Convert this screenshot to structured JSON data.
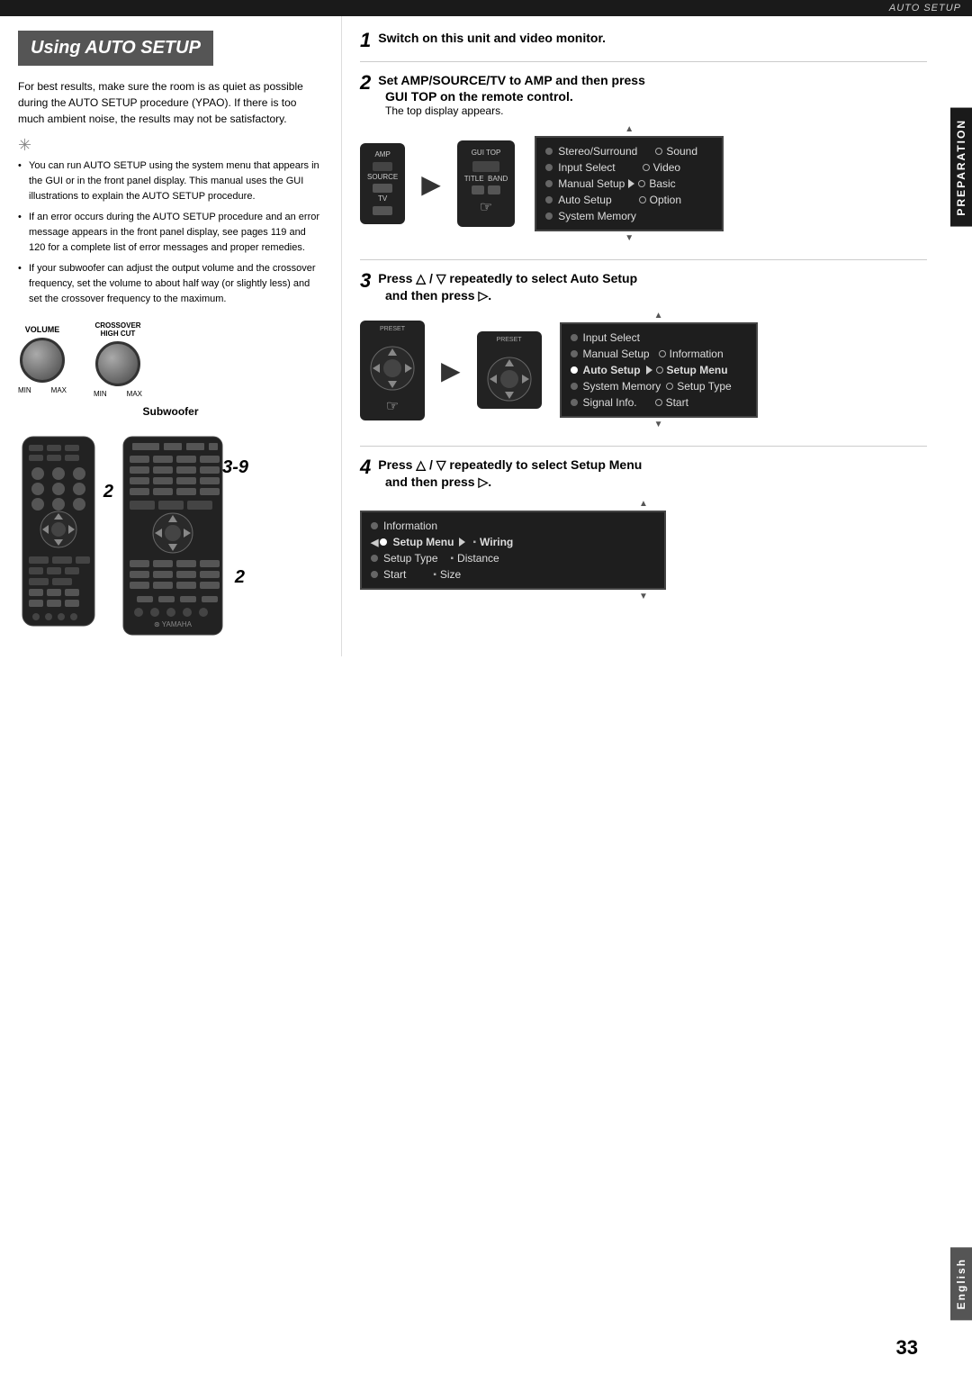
{
  "top_bar": {
    "label": "AUTO SETUP"
  },
  "section": {
    "title": "Using AUTO SETUP"
  },
  "left_col": {
    "intro": "For best results, make sure the room is as quiet as possible during the AUTO SETUP procedure (YPAO). If there is too much ambient noise, the results may not be satisfactory.",
    "tip_bullets": [
      "You can run AUTO SETUP using the system menu that appears in the GUI or in the front panel display. This manual uses the GUI illustrations to explain the AUTO SETUP procedure.",
      "If an error occurs during the AUTO SETUP procedure and an error message appears in the front panel display, see pages 119 and 120 for a complete list of error messages and proper remedies.",
      "If your subwoofer can adjust the output volume and the crossover frequency, set the volume to about half way (or slightly less) and set the crossover frequency to the maximum."
    ],
    "subwoofer_label": "Subwoofer",
    "knob1_label": "VOLUME",
    "knob2_label": "CROSSOVER\nHIGH CUT",
    "knob1_min": "MIN",
    "knob1_max": "MAX",
    "knob2_min": "MIN",
    "knob2_max": "MAX",
    "remote_num1": "2",
    "remote_num2": "3-9",
    "remote_num3": "2"
  },
  "side_tab": {
    "label": "PREPARATION"
  },
  "side_tab_bottom": {
    "label": "English"
  },
  "steps": {
    "step1": {
      "num": "1",
      "text": "Switch on this unit and video monitor."
    },
    "step2": {
      "num": "2",
      "text": "Set AMP/SOURCE/TV to AMP and then press",
      "text2": "GUI TOP on the remote control.",
      "note": "The top display appears."
    },
    "step3": {
      "num": "3",
      "text": "Press △ / ▽ repeatedly to select Auto Setup",
      "text2": "and then press ▷."
    },
    "step4": {
      "num": "4",
      "text": "Press △ / ▽ repeatedly to select Setup Menu",
      "text2": "and then press ▷."
    }
  },
  "menu1": {
    "scroll_up": "▲",
    "scroll_down": "▼",
    "items_left": [
      {
        "label": "Stereo/Surround",
        "selected": false
      },
      {
        "label": "Input Select",
        "selected": false
      },
      {
        "label": "Manual Setup",
        "selected": false,
        "has_arrow": true
      },
      {
        "label": "Auto Setup",
        "selected": false
      },
      {
        "label": "System Memory",
        "selected": false
      }
    ],
    "items_right": [
      {
        "label": "Sound",
        "selected": false
      },
      {
        "label": "Video",
        "selected": false
      },
      {
        "label": "Basic",
        "selected": false
      },
      {
        "label": "Option",
        "selected": false
      }
    ]
  },
  "menu2": {
    "scroll_up": "▲",
    "scroll_down": "▼",
    "items_left": [
      {
        "label": "Input Select",
        "selected": false
      },
      {
        "label": "Manual Setup",
        "selected": false
      },
      {
        "label": "Auto Setup",
        "selected": true,
        "has_arrow": true
      },
      {
        "label": "System Memory",
        "selected": false
      },
      {
        "label": "Signal Info.",
        "selected": false
      }
    ],
    "items_right": [
      {
        "label": "Information",
        "selected": false
      },
      {
        "label": "Setup Menu",
        "selected": false
      },
      {
        "label": "Setup Type",
        "selected": false
      },
      {
        "label": "Start",
        "selected": false
      }
    ]
  },
  "menu3": {
    "scroll_up": "▲",
    "scroll_down": "▼",
    "items_left": [
      {
        "label": "Information",
        "selected": false
      },
      {
        "label": "Setup Menu",
        "selected": true,
        "has_arrow": true
      },
      {
        "label": "Setup Type",
        "selected": false
      },
      {
        "label": "Start",
        "selected": false
      }
    ],
    "items_right": [
      {
        "label": "Wiring",
        "selected": false
      },
      {
        "label": "Distance",
        "selected": false
      },
      {
        "label": "Size",
        "selected": false
      }
    ]
  },
  "page_number": "33",
  "remote_labels": {
    "amp": "AMP",
    "source": "SOURCE",
    "tv": "TV",
    "gui_top": "GUI TOP",
    "title": "TITLE",
    "band": "BAND",
    "preset": "PRESET"
  }
}
